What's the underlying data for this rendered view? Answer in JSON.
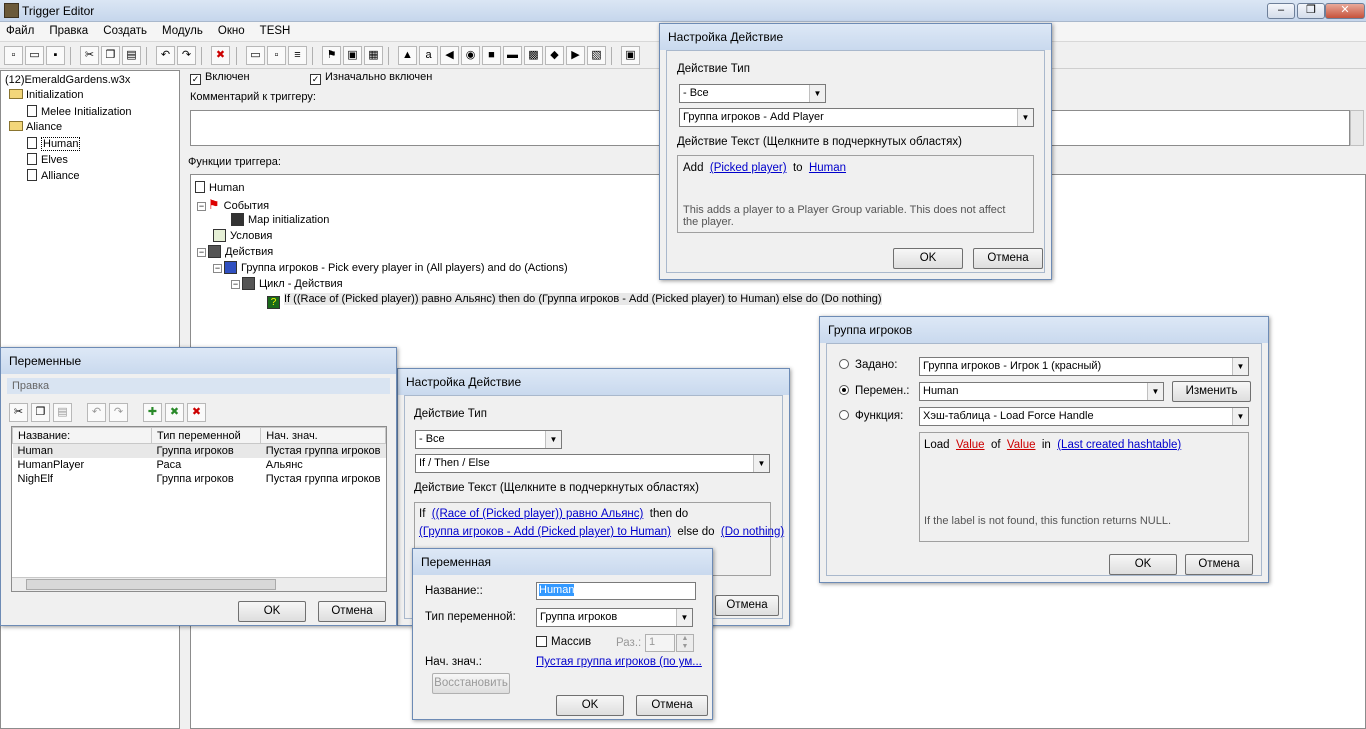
{
  "window": {
    "title": "Trigger Editor"
  },
  "menu": [
    "Файл",
    "Правка",
    "Создать",
    "Модуль",
    "Окно",
    "TESH"
  ],
  "tree": {
    "root": "(12)EmeraldGardens.w3x",
    "items": [
      {
        "label": "Initialization",
        "type": "folder"
      },
      {
        "label": "Melee Initialization",
        "type": "trigger"
      },
      {
        "label": "Aliance",
        "type": "folder"
      },
      {
        "label": "Human",
        "type": "trigger"
      },
      {
        "label": "Elves",
        "type": "trigger"
      },
      {
        "label": "Alliance",
        "type": "trigger"
      }
    ]
  },
  "trigger": {
    "enabled_label": "Включен",
    "initially_enabled_label": "Изначально включен",
    "comment_label": "Комментарий к триггеру:",
    "functions_label": "Функции триггера:",
    "nodes": {
      "root": "Human",
      "events": "События",
      "event_1": "Map initialization",
      "conditions": "Условия",
      "actions": "Действия",
      "action_1": "Группа игроков - Pick every player in (All players) and do (Actions)",
      "loop": "Цикл - Действия",
      "loop_action": "If ((Race of (Picked player)) равно Альянс) then do (Группа игроков - Add (Picked player) to Human) else do (Do nothing)"
    }
  },
  "dialog_action_top": {
    "title": "Настройка Действие",
    "type_label": "Действие Тип",
    "category": "- Все",
    "action": "Группа игроков - Add Player",
    "text_label": "Действие Текст (Щелкните в подчеркнутых областях)",
    "text_word_1": "Add",
    "text_link_1": "(Picked player)",
    "text_word_2": "to",
    "text_link_2": "Human",
    "description": "This adds a player to a Player Group variable.  This does not affect the player.",
    "ok": "OK",
    "cancel": "Отмена"
  },
  "dialog_playergroup": {
    "title": "Группа игроков",
    "preset_label": "Задано:",
    "preset_value": "Группа игроков - Игрок 1 (красный)",
    "variable_label": "Перемен.:",
    "variable_value": "Human",
    "edit_button": "Изменить",
    "function_label": "Функция:",
    "function_value": "Хэш-таблица - Load Force Handle",
    "text_word_1": "Load",
    "text_link_1": "Value",
    "text_word_2": "of",
    "text_link_2": "Value",
    "text_word_3": "in",
    "text_link_3": "(Last created hashtable)",
    "description": "If the label is not found, this function returns NULL.",
    "ok": "OK",
    "cancel": "Отмена"
  },
  "dialog_variables": {
    "title": "Переменные",
    "menu": "Правка",
    "columns": [
      "Название:",
      "Тип переменной",
      "Нач. знач."
    ],
    "rows": [
      [
        "Human",
        "Группа игроков",
        "Пустая группа игроков"
      ],
      [
        "HumanPlayer",
        "Раса",
        "Альянс"
      ],
      [
        "NighElf",
        "Группа игроков",
        "Пустая группа игроков"
      ]
    ],
    "ok": "OK",
    "cancel": "Отмена"
  },
  "dialog_action_bottom": {
    "title": "Настройка Действие",
    "type_label": "Действие Тип",
    "category": "- Все",
    "action": "If / Then / Else",
    "text_label": "Действие Текст (Щелкните в подчеркнутых областях)",
    "text_word_1": "If",
    "text_link_1": "((Race of (Picked player)) равно Альянс)",
    "text_word_2": "then do",
    "text_link_2": "(Группа игроков - Add (Picked player) to Human)",
    "text_word_3": "else do",
    "text_link_3": "(Do nothing)",
    "cancel": "Отмена"
  },
  "dialog_variable": {
    "title": "Переменная",
    "name_label": "Название::",
    "name_value": "Human",
    "type_label": "Тип переменной:",
    "type_value": "Группа игроков",
    "array_label": "Массив",
    "size_label": "Раз.:",
    "size_value": "1",
    "initial_label": "Нач. знач.:",
    "initial_value": "Пустая группа игроков (по ум...",
    "restore_button": "Восстановить",
    "ok": "OK",
    "cancel": "Отмена"
  }
}
